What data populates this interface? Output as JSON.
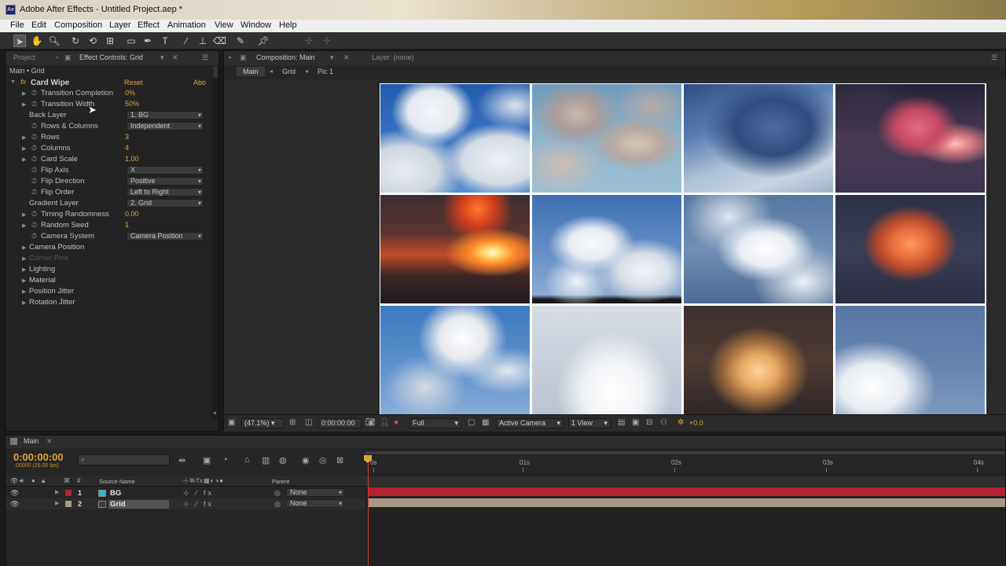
{
  "window": {
    "title": "Adobe After Effects - Untitled Project.aep *",
    "app_icon": "Ae"
  },
  "menu": [
    "File",
    "Edit",
    "Composition",
    "Layer",
    "Effect",
    "Animation",
    "View",
    "Window",
    "Help"
  ],
  "tools": [
    "selection-tool-icon",
    "hand-tool-icon",
    "zoom-tool-icon",
    "rotate-tool-icon",
    "orbit-camera-icon",
    "pan-behind-icon",
    "rectangle-tool-icon",
    "pen-tool-icon",
    "type-tool-icon",
    "brush-tool-icon",
    "clone-stamp-icon",
    "eraser-tool-icon",
    "roto-brush-icon",
    "puppet-pin-icon"
  ],
  "effects_panel": {
    "tab_project": "Project",
    "tab_effects": "Effect Controls: Grid",
    "breadcrumb": "Main • Grid",
    "effect_name": "Card Wipe",
    "reset": "Reset",
    "about": "Abo",
    "props": [
      {
        "label": "Transition Completion",
        "value": "0%",
        "kind": "val",
        "stop": true,
        "tri": true
      },
      {
        "label": "Transition Width",
        "value": "50%",
        "kind": "val",
        "stop": true,
        "tri": true
      },
      {
        "label": "Back Layer",
        "value": "1. BG",
        "kind": "dd",
        "stop": false,
        "tri": false
      },
      {
        "label": "Rows & Columns",
        "value": "Independent",
        "kind": "dd",
        "stop": true,
        "tri": false
      },
      {
        "label": "Rows",
        "value": "3",
        "kind": "val",
        "stop": true,
        "tri": true
      },
      {
        "label": "Columns",
        "value": "4",
        "kind": "val",
        "stop": true,
        "tri": true
      },
      {
        "label": "Card Scale",
        "value": "1.00",
        "kind": "val",
        "stop": true,
        "tri": true
      },
      {
        "label": "Flip Axis",
        "value": "X",
        "kind": "dd",
        "stop": true,
        "tri": false
      },
      {
        "label": "Flip Direction",
        "value": "Positive",
        "kind": "dd",
        "stop": true,
        "tri": false
      },
      {
        "label": "Flip Order",
        "value": "Left to Right",
        "kind": "dd",
        "stop": true,
        "tri": false
      },
      {
        "label": "Gradient Layer",
        "value": "2. Grid",
        "kind": "dd",
        "stop": false,
        "tri": false
      },
      {
        "label": "Timing Randomness",
        "value": "0.00",
        "kind": "val",
        "stop": true,
        "tri": true
      },
      {
        "label": "Random Seed",
        "value": "1",
        "kind": "val",
        "stop": true,
        "tri": true
      },
      {
        "label": "Camera System",
        "value": "Camera Position",
        "kind": "dd",
        "stop": true,
        "tri": false
      }
    ],
    "groups": [
      "Camera Position",
      "Corner Pins",
      "Lighting",
      "Material",
      "Position Jitter",
      "Rotation Jitter"
    ]
  },
  "comp_panel": {
    "tab": "Composition: Main",
    "layer_tab": "Layer: (none)",
    "crumbs": [
      "Main",
      "Grid",
      "Pic 1"
    ],
    "zoom": "(47.1%)",
    "timecode": "0:00:00:00",
    "resolution": "Full",
    "camera": "Active Camera",
    "view": "1 View",
    "exposure": "+0.0"
  },
  "timeline": {
    "tab": "Main",
    "timecode": "0:00:00:00",
    "fps": "00000 (25.00 fps)",
    "search_placeholder": "",
    "col_source": "Source Name",
    "col_parent": "Parent",
    "ruler": [
      "0s",
      "01s",
      "02s",
      "03s",
      "04s"
    ],
    "layers": [
      {
        "num": "1",
        "name": "BG",
        "color": "#2fb7d6",
        "parent": "None",
        "label_color": "#b4232f"
      },
      {
        "num": "2",
        "name": "Grid",
        "color": "#3a3a3a",
        "parent": "None",
        "label_color": "#a89a88"
      }
    ]
  },
  "colors": {
    "accent": "#e0a33a",
    "playhead": "#d13a2a",
    "layer1_bar": "#b4232f",
    "layer2_bar": "#a89a88"
  }
}
